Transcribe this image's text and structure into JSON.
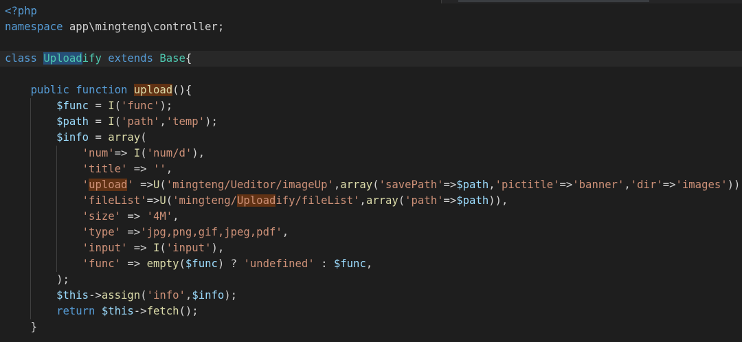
{
  "editor": {
    "language": "php",
    "highlight_term": "Upload",
    "lines": [
      {
        "tokens": [
          {
            "t": "<?php",
            "c": "tok-tag"
          }
        ]
      },
      {
        "tokens": [
          {
            "t": "namespace",
            "c": "tok-kw"
          },
          {
            "t": " app\\mingteng\\controller;",
            "c": "tok-plain"
          }
        ]
      },
      {
        "tokens": []
      },
      {
        "current": true,
        "tokens": [
          {
            "t": "class",
            "c": "tok-kw"
          },
          {
            "t": " ",
            "c": "tok-plain"
          },
          {
            "t": "Upload",
            "c": "tok-class",
            "hl": "hl-sel"
          },
          {
            "t": "ify",
            "c": "tok-class"
          },
          {
            "t": " ",
            "c": "tok-plain"
          },
          {
            "t": "extends",
            "c": "tok-kw"
          },
          {
            "t": " ",
            "c": "tok-plain"
          },
          {
            "t": "Base",
            "c": "tok-class"
          },
          {
            "t": "{",
            "c": "tok-plain"
          }
        ]
      },
      {
        "tokens": []
      },
      {
        "tokens": [
          {
            "t": "    ",
            "c": "tok-plain"
          },
          {
            "t": "public",
            "c": "tok-kw"
          },
          {
            "t": " ",
            "c": "tok-plain"
          },
          {
            "t": "function",
            "c": "tok-kw"
          },
          {
            "t": " ",
            "c": "tok-plain"
          },
          {
            "t": "upload",
            "c": "tok-fn",
            "hl": "hl-find"
          },
          {
            "t": "(){",
            "c": "tok-plain"
          }
        ]
      },
      {
        "tokens": [
          {
            "t": "        ",
            "c": "tok-plain"
          },
          {
            "t": "$func",
            "c": "tok-var"
          },
          {
            "t": " = ",
            "c": "tok-plain"
          },
          {
            "t": "I",
            "c": "tok-fn"
          },
          {
            "t": "(",
            "c": "tok-plain"
          },
          {
            "t": "'func'",
            "c": "tok-str"
          },
          {
            "t": ");",
            "c": "tok-plain"
          }
        ]
      },
      {
        "tokens": [
          {
            "t": "        ",
            "c": "tok-plain"
          },
          {
            "t": "$path",
            "c": "tok-var"
          },
          {
            "t": " = ",
            "c": "tok-plain"
          },
          {
            "t": "I",
            "c": "tok-fn"
          },
          {
            "t": "(",
            "c": "tok-plain"
          },
          {
            "t": "'path'",
            "c": "tok-str"
          },
          {
            "t": ",",
            "c": "tok-plain"
          },
          {
            "t": "'temp'",
            "c": "tok-str"
          },
          {
            "t": ");",
            "c": "tok-plain"
          }
        ]
      },
      {
        "tokens": [
          {
            "t": "        ",
            "c": "tok-plain"
          },
          {
            "t": "$info",
            "c": "tok-var"
          },
          {
            "t": " = ",
            "c": "tok-plain"
          },
          {
            "t": "array",
            "c": "tok-fn"
          },
          {
            "t": "(",
            "c": "tok-plain"
          }
        ]
      },
      {
        "tokens": [
          {
            "t": "            ",
            "c": "tok-plain"
          },
          {
            "t": "'num'",
            "c": "tok-str"
          },
          {
            "t": "=> ",
            "c": "tok-plain"
          },
          {
            "t": "I",
            "c": "tok-fn"
          },
          {
            "t": "(",
            "c": "tok-plain"
          },
          {
            "t": "'num/d'",
            "c": "tok-str"
          },
          {
            "t": "),",
            "c": "tok-plain"
          }
        ]
      },
      {
        "tokens": [
          {
            "t": "            ",
            "c": "tok-plain"
          },
          {
            "t": "'title'",
            "c": "tok-str"
          },
          {
            "t": " => ",
            "c": "tok-plain"
          },
          {
            "t": "''",
            "c": "tok-str"
          },
          {
            "t": ",",
            "c": "tok-plain"
          }
        ]
      },
      {
        "tokens": [
          {
            "t": "            ",
            "c": "tok-plain"
          },
          {
            "t": "'",
            "c": "tok-str"
          },
          {
            "t": "upload",
            "c": "tok-str",
            "hl": "hl-find"
          },
          {
            "t": "'",
            "c": "tok-str"
          },
          {
            "t": " =>",
            "c": "tok-plain"
          },
          {
            "t": "U",
            "c": "tok-fn"
          },
          {
            "t": "(",
            "c": "tok-plain"
          },
          {
            "t": "'mingteng/Ueditor/imageUp'",
            "c": "tok-str"
          },
          {
            "t": ",",
            "c": "tok-plain"
          },
          {
            "t": "array",
            "c": "tok-fn"
          },
          {
            "t": "(",
            "c": "tok-plain"
          },
          {
            "t": "'savePath'",
            "c": "tok-str"
          },
          {
            "t": "=>",
            "c": "tok-plain"
          },
          {
            "t": "$path",
            "c": "tok-var"
          },
          {
            "t": ",",
            "c": "tok-plain"
          },
          {
            "t": "'pictitle'",
            "c": "tok-str"
          },
          {
            "t": "=>",
            "c": "tok-plain"
          },
          {
            "t": "'banner'",
            "c": "tok-str"
          },
          {
            "t": ",",
            "c": "tok-plain"
          },
          {
            "t": "'dir'",
            "c": "tok-str"
          },
          {
            "t": "=>",
            "c": "tok-plain"
          },
          {
            "t": "'images'",
            "c": "tok-str"
          },
          {
            "t": ")),",
            "c": "tok-plain"
          }
        ]
      },
      {
        "tokens": [
          {
            "t": "            ",
            "c": "tok-plain"
          },
          {
            "t": "'fileList'",
            "c": "tok-str"
          },
          {
            "t": "=>",
            "c": "tok-plain"
          },
          {
            "t": "U",
            "c": "tok-fn"
          },
          {
            "t": "(",
            "c": "tok-plain"
          },
          {
            "t": "'mingteng/",
            "c": "tok-str"
          },
          {
            "t": "Upload",
            "c": "tok-str",
            "hl": "hl-find"
          },
          {
            "t": "ify/fileList'",
            "c": "tok-str"
          },
          {
            "t": ",",
            "c": "tok-plain"
          },
          {
            "t": "array",
            "c": "tok-fn"
          },
          {
            "t": "(",
            "c": "tok-plain"
          },
          {
            "t": "'path'",
            "c": "tok-str"
          },
          {
            "t": "=>",
            "c": "tok-plain"
          },
          {
            "t": "$path",
            "c": "tok-var"
          },
          {
            "t": ")),",
            "c": "tok-plain"
          }
        ]
      },
      {
        "tokens": [
          {
            "t": "            ",
            "c": "tok-plain"
          },
          {
            "t": "'size'",
            "c": "tok-str"
          },
          {
            "t": " => ",
            "c": "tok-plain"
          },
          {
            "t": "'4M'",
            "c": "tok-str"
          },
          {
            "t": ",",
            "c": "tok-plain"
          }
        ]
      },
      {
        "tokens": [
          {
            "t": "            ",
            "c": "tok-plain"
          },
          {
            "t": "'type'",
            "c": "tok-str"
          },
          {
            "t": " =>",
            "c": "tok-plain"
          },
          {
            "t": "'jpg,png,gif,jpeg,pdf'",
            "c": "tok-str"
          },
          {
            "t": ",",
            "c": "tok-plain"
          }
        ]
      },
      {
        "tokens": [
          {
            "t": "            ",
            "c": "tok-plain"
          },
          {
            "t": "'input'",
            "c": "tok-str"
          },
          {
            "t": " => ",
            "c": "tok-plain"
          },
          {
            "t": "I",
            "c": "tok-fn"
          },
          {
            "t": "(",
            "c": "tok-plain"
          },
          {
            "t": "'input'",
            "c": "tok-str"
          },
          {
            "t": "),",
            "c": "tok-plain"
          }
        ]
      },
      {
        "tokens": [
          {
            "t": "            ",
            "c": "tok-plain"
          },
          {
            "t": "'func'",
            "c": "tok-str"
          },
          {
            "t": " => ",
            "c": "tok-plain"
          },
          {
            "t": "empty",
            "c": "tok-fn"
          },
          {
            "t": "(",
            "c": "tok-plain"
          },
          {
            "t": "$func",
            "c": "tok-var"
          },
          {
            "t": ") ? ",
            "c": "tok-plain"
          },
          {
            "t": "'undefined'",
            "c": "tok-str"
          },
          {
            "t": " : ",
            "c": "tok-plain"
          },
          {
            "t": "$func",
            "c": "tok-var"
          },
          {
            "t": ",",
            "c": "tok-plain"
          }
        ]
      },
      {
        "tokens": [
          {
            "t": "        ",
            "c": "tok-plain"
          },
          {
            "t": ");",
            "c": "tok-plain"
          }
        ]
      },
      {
        "tokens": [
          {
            "t": "        ",
            "c": "tok-plain"
          },
          {
            "t": "$this",
            "c": "tok-var"
          },
          {
            "t": "->",
            "c": "tok-plain"
          },
          {
            "t": "assign",
            "c": "tok-fn"
          },
          {
            "t": "(",
            "c": "tok-plain"
          },
          {
            "t": "'info'",
            "c": "tok-str"
          },
          {
            "t": ",",
            "c": "tok-plain"
          },
          {
            "t": "$info",
            "c": "tok-var"
          },
          {
            "t": ");",
            "c": "tok-plain"
          }
        ]
      },
      {
        "tokens": [
          {
            "t": "        ",
            "c": "tok-plain"
          },
          {
            "t": "return",
            "c": "tok-kw"
          },
          {
            "t": " ",
            "c": "tok-plain"
          },
          {
            "t": "$this",
            "c": "tok-var"
          },
          {
            "t": "->",
            "c": "tok-plain"
          },
          {
            "t": "fetch",
            "c": "tok-fn"
          },
          {
            "t": "();",
            "c": "tok-plain"
          }
        ]
      },
      {
        "tokens": [
          {
            "t": "    ",
            "c": "tok-plain"
          },
          {
            "t": "}",
            "c": "tok-plain"
          }
        ]
      }
    ]
  }
}
